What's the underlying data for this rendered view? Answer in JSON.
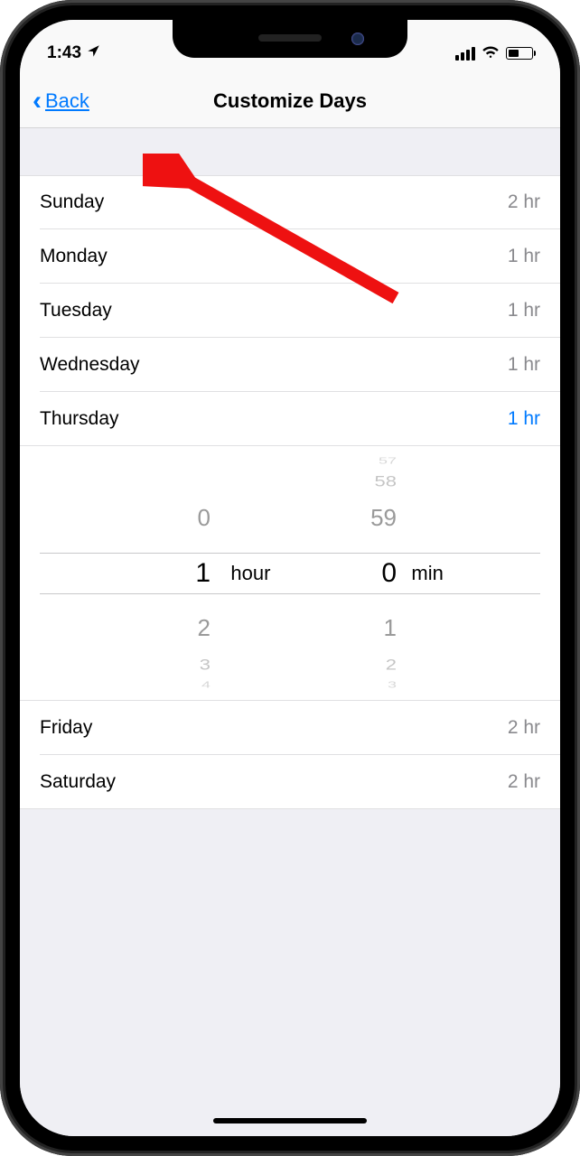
{
  "status": {
    "time": "1:43",
    "location_icon": "location-arrow"
  },
  "nav": {
    "back_label": "Back",
    "title": "Customize Days"
  },
  "days": [
    {
      "name": "Sunday",
      "value": "2 hr",
      "active": false
    },
    {
      "name": "Monday",
      "value": "1 hr",
      "active": false
    },
    {
      "name": "Tuesday",
      "value": "1 hr",
      "active": false
    },
    {
      "name": "Wednesday",
      "value": "1 hr",
      "active": false
    },
    {
      "name": "Thursday",
      "value": "1 hr",
      "active": true
    }
  ],
  "days_after": [
    {
      "name": "Friday",
      "value": "2 hr",
      "active": false
    },
    {
      "name": "Saturday",
      "value": "2 hr",
      "active": false
    }
  ],
  "picker": {
    "hours": {
      "visible": [
        "0",
        "1",
        "2",
        "3",
        "4"
      ],
      "selected": "1",
      "unit": "hour"
    },
    "minutes": {
      "visible": [
        "57",
        "58",
        "59",
        "0",
        "1",
        "2",
        "3"
      ],
      "selected": "0",
      "unit": "min"
    }
  }
}
